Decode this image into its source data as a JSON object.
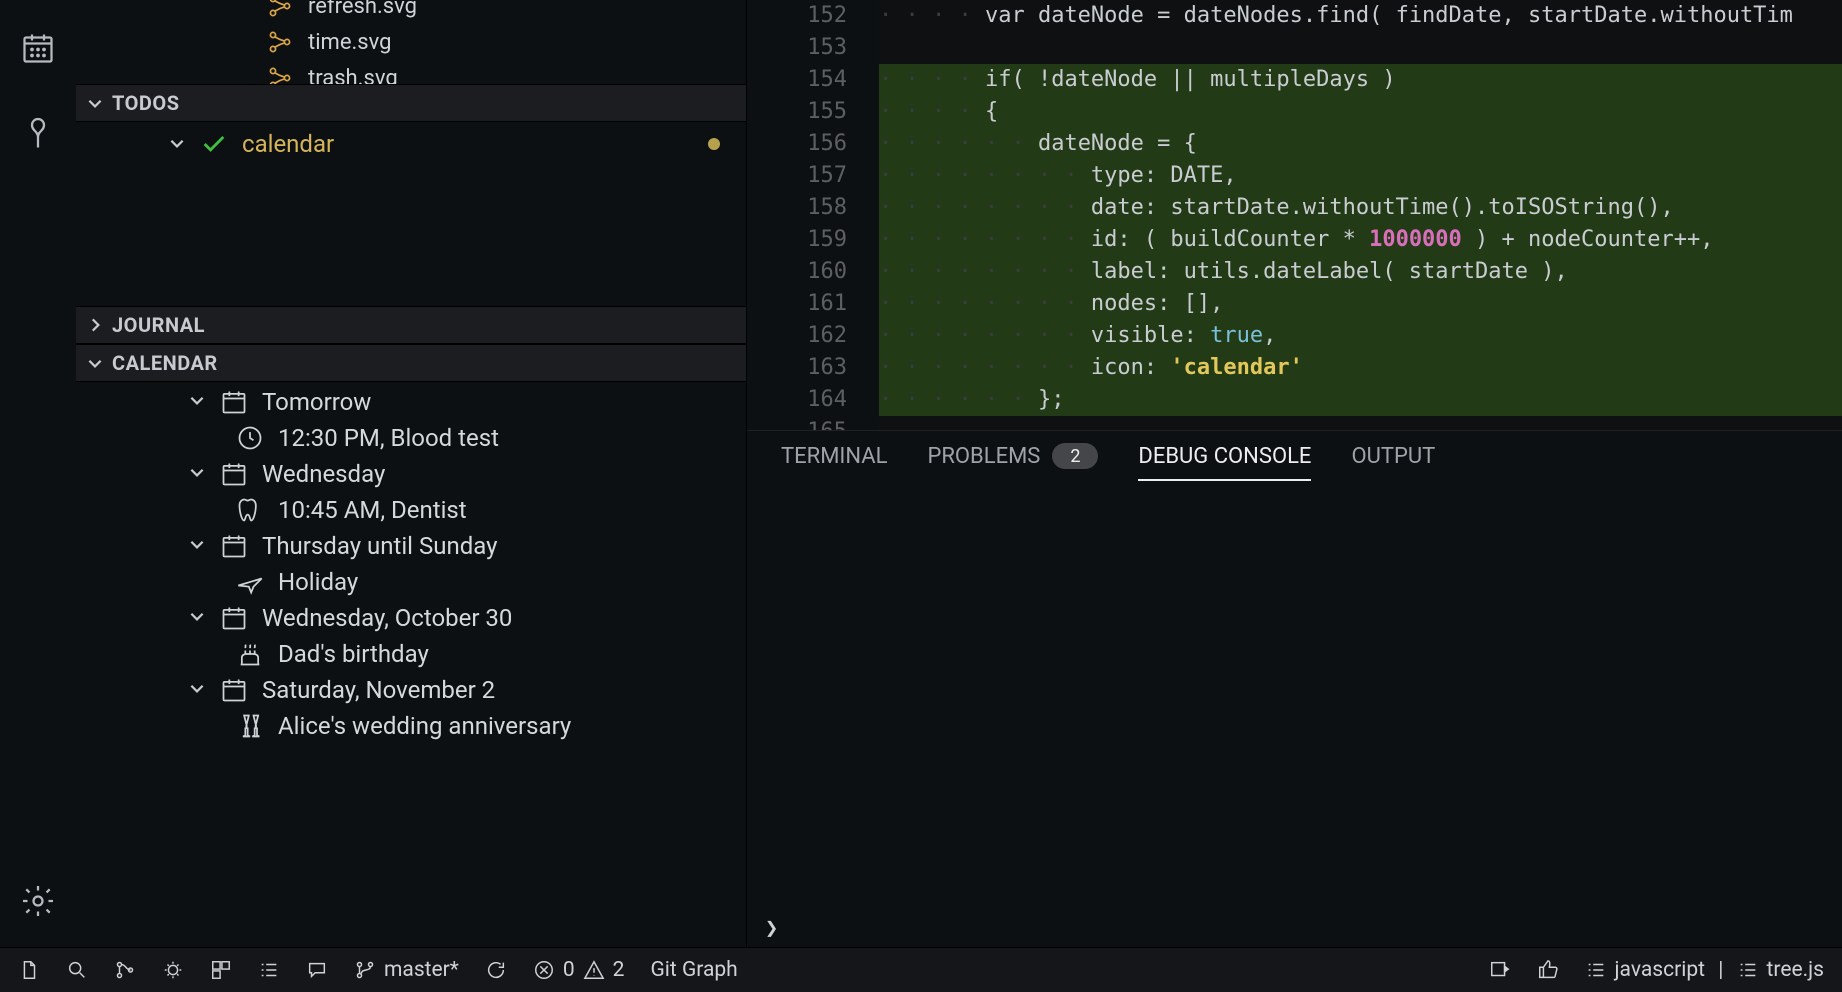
{
  "sidebar": {
    "files": [
      "refresh.svg",
      "time.svg",
      "trash.svg"
    ],
    "sections": {
      "todos": "TODOS",
      "journal": "JOURNAL",
      "calendar": "CALENDAR"
    },
    "todo_item": "calendar",
    "calendar": [
      {
        "type": "group",
        "label": "Tomorrow",
        "icon": "calendar"
      },
      {
        "type": "event",
        "label": "12:30 PM, Blood test",
        "icon": "clock"
      },
      {
        "type": "group",
        "label": "Wednesday",
        "icon": "calendar"
      },
      {
        "type": "event",
        "label": "10:45 AM, Dentist",
        "icon": "tooth"
      },
      {
        "type": "group",
        "label": "Thursday until Sunday",
        "icon": "calendar"
      },
      {
        "type": "event",
        "label": "Holiday",
        "icon": "plane"
      },
      {
        "type": "group",
        "label": "Wednesday, October 30",
        "icon": "calendar"
      },
      {
        "type": "event",
        "label": "Dad's birthday",
        "icon": "cake"
      },
      {
        "type": "group",
        "label": "Saturday, November 2",
        "icon": "calendar"
      },
      {
        "type": "event",
        "label": "Alice's wedding anniversary",
        "icon": "champagne"
      }
    ]
  },
  "editor": {
    "line_start": 152,
    "lines": [
      "        var dateNode = dateNodes.find( findDate, startDate.withoutTim",
      "",
      "        if( !dateNode || multipleDays )",
      "        {",
      "            dateNode = {",
      "                type: DATE,",
      "                date: startDate.withoutTime().toISOString(),",
      "                id: ( buildCounter * 1000000 ) + nodeCounter++,",
      "                label: utils.dateLabel( startDate ),",
      "                nodes: [],",
      "                visible: true,",
      "                icon: 'calendar'",
      "            };",
      ""
    ]
  },
  "panel": {
    "tabs": {
      "terminal": "TERMINAL",
      "problems": "PROBLEMS",
      "problems_count": "2",
      "debug": "DEBUG CONSOLE",
      "output": "OUTPUT"
    },
    "repl_prompt": "❯"
  },
  "statusbar": {
    "branch": "master*",
    "errors": "0",
    "warnings": "2",
    "git_graph": "Git Graph",
    "lang": "javascript",
    "file": "tree.js"
  }
}
